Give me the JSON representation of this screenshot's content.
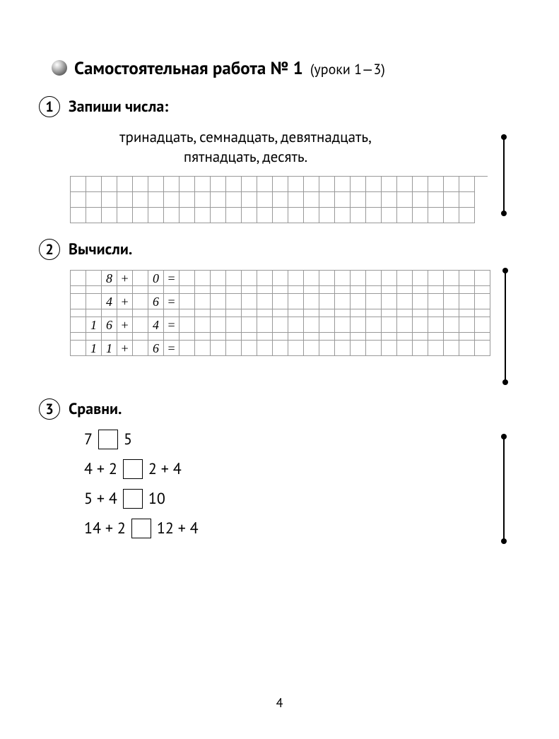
{
  "title": {
    "main": "Самостоятельная работа № 1",
    "sub": "(уроки 1—3)"
  },
  "task1": {
    "num": "1",
    "label": "Запиши числа:",
    "prompt_line1": "тринадцать, семнадцать, девятнадцать,",
    "prompt_line2": "пятнадцать, десять.",
    "grid": {
      "cols": 26,
      "rows": 3
    }
  },
  "task2": {
    "num": "2",
    "label": "Вычисли.",
    "grid": {
      "cols": 27
    },
    "exprs": [
      [
        " ",
        "8",
        "+",
        " ",
        "0",
        "="
      ],
      [
        " ",
        "4",
        "+",
        " ",
        "6",
        "="
      ],
      [
        "1",
        "6",
        "+",
        " ",
        "4",
        "="
      ],
      [
        "1",
        "1",
        "+",
        " ",
        "6",
        "="
      ]
    ]
  },
  "task3": {
    "num": "3",
    "label": "Сравни.",
    "rows": [
      {
        "left": "7",
        "right": "5"
      },
      {
        "left": "4 + 2",
        "right": "2 + 4"
      },
      {
        "left": "5 + 4",
        "right": "10"
      },
      {
        "left": "14 + 2",
        "right": "12 + 4"
      }
    ]
  },
  "page": "4"
}
